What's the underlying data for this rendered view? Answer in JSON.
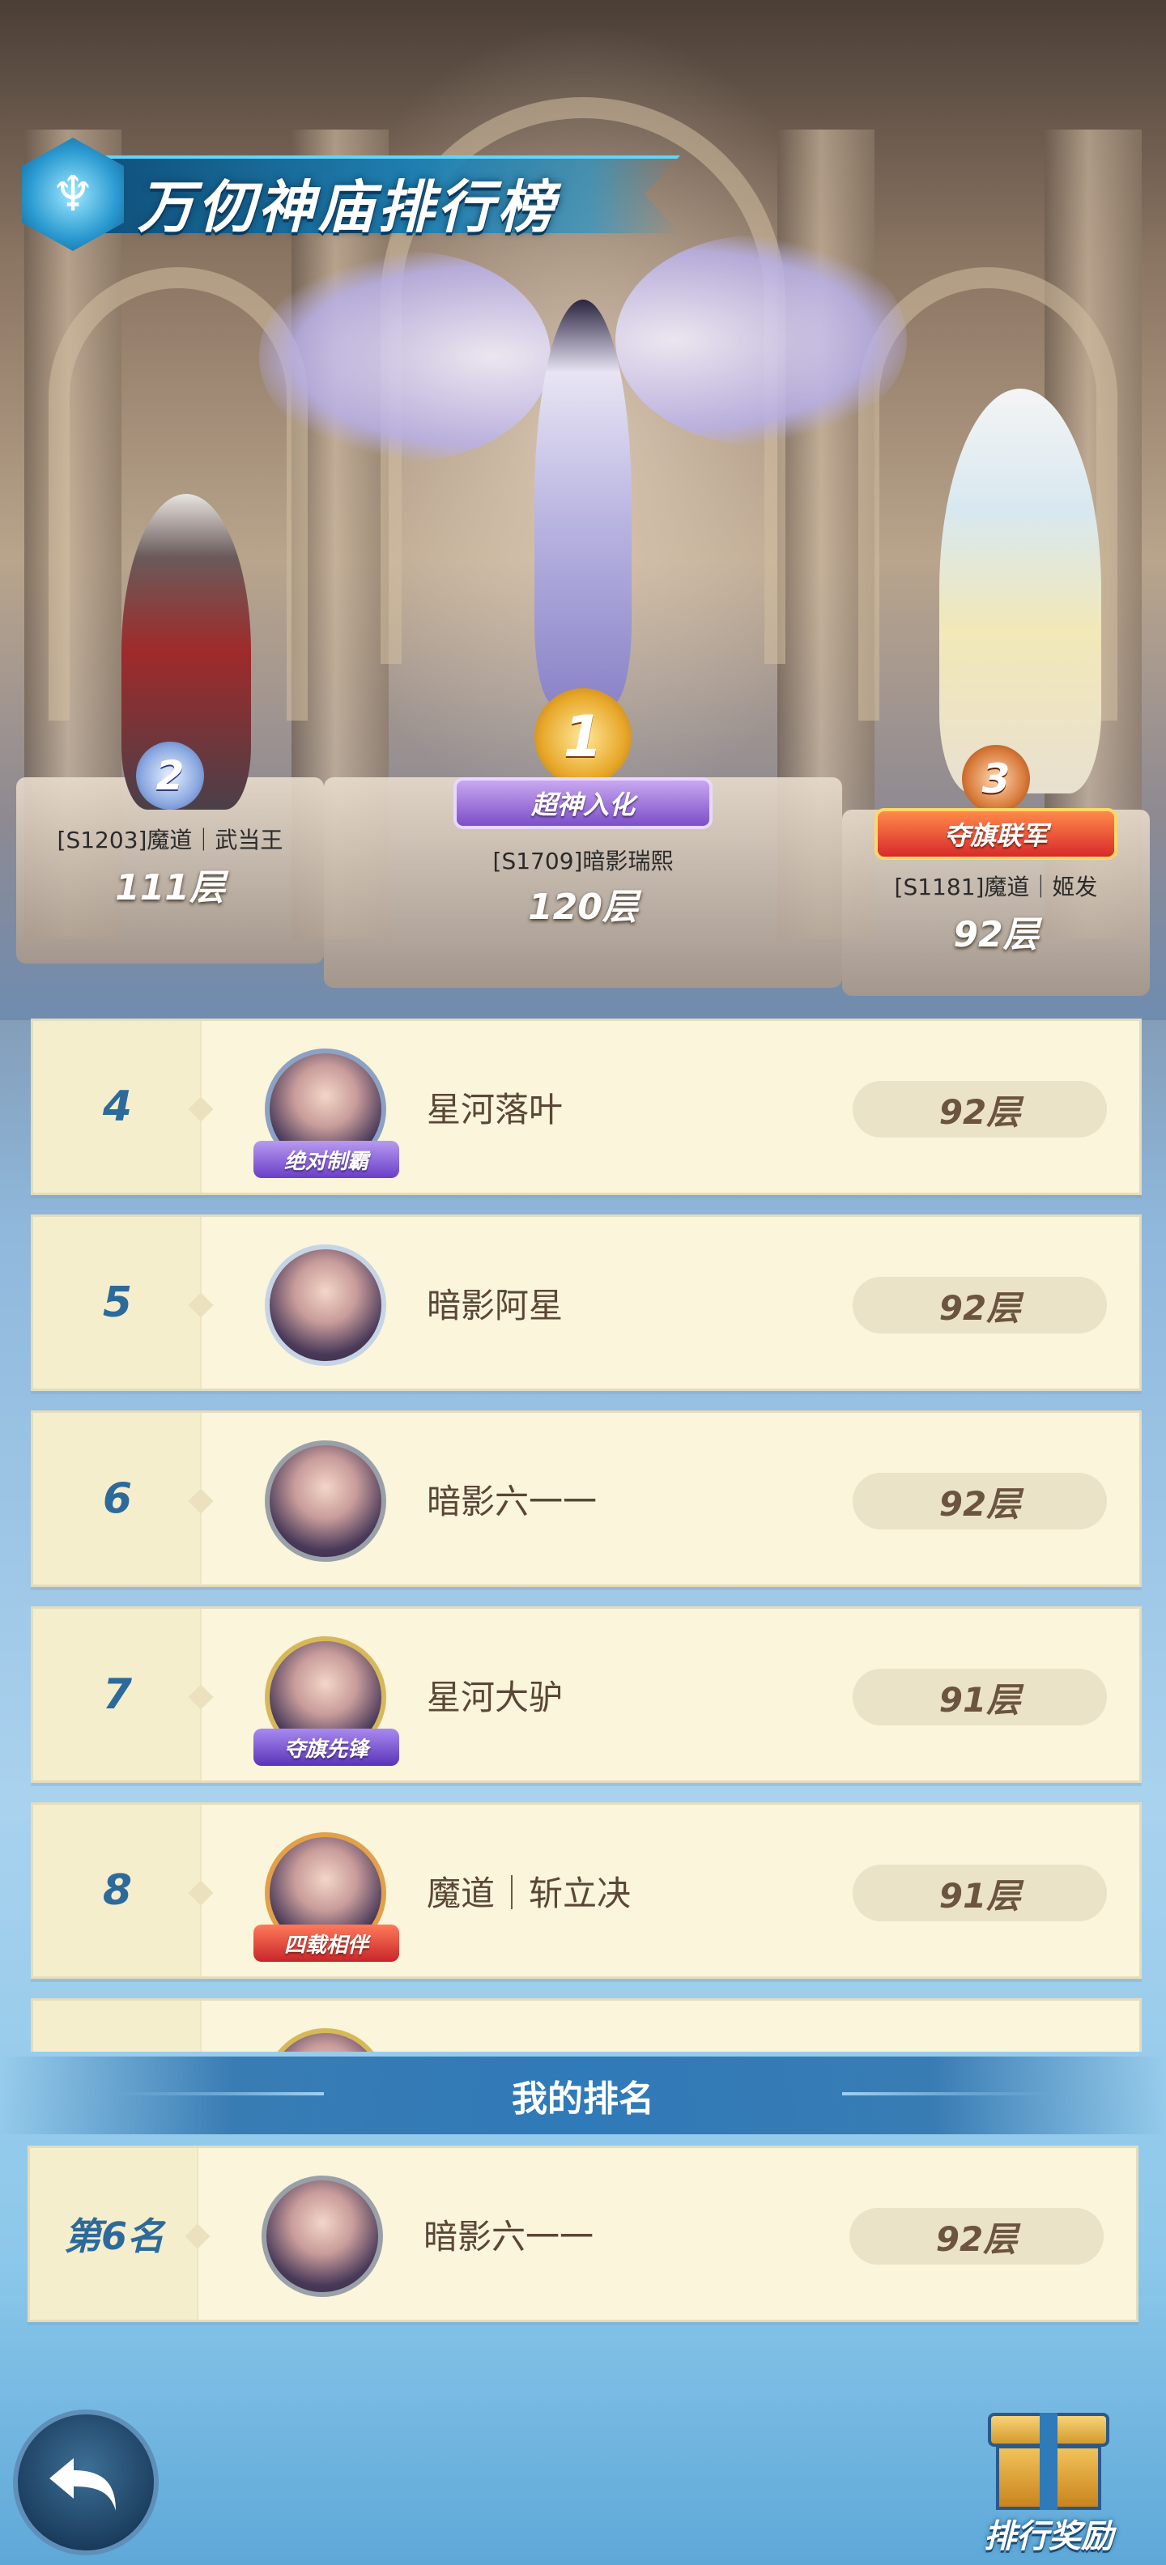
{
  "title": "万仞神庙排行榜",
  "podium": [
    {
      "rank": "1",
      "server_name": "[S1709]暗影瑞熙",
      "floors": "120层",
      "badge": "超神入化"
    },
    {
      "rank": "2",
      "server_name": "[S1203]魔道｜武当王",
      "floors": "111层",
      "badge": ""
    },
    {
      "rank": "3",
      "server_name": "[S1181]魔道｜姬发",
      "floors": "92层",
      "badge": "夺旗联军"
    }
  ],
  "rankings": [
    {
      "rank": "4",
      "name": "星河落叶",
      "floors": "92层",
      "frame_tag": "绝对制霸"
    },
    {
      "rank": "5",
      "name": "暗影阿星",
      "floors": "92层",
      "frame_tag": ""
    },
    {
      "rank": "6",
      "name": "暗影六一一",
      "floors": "92层",
      "frame_tag": ""
    },
    {
      "rank": "7",
      "name": "星河大驴",
      "floors": "91层",
      "frame_tag": "夺旗先锋"
    },
    {
      "rank": "8",
      "name": "魔道｜斩立决",
      "floors": "91层",
      "frame_tag": "四载相伴"
    }
  ],
  "my_ranking": {
    "header": "我的排名",
    "rank_label": "第6名",
    "name": "暗影六一一",
    "floors": "92层"
  },
  "buttons": {
    "reward_label": "排行奖励"
  },
  "icons": {
    "back": "back-arrow-icon",
    "reward": "gift-box-icon",
    "title_emblem": "crest-icon"
  },
  "colors": {
    "rank_number": "#2d6a9c",
    "row_background": "#faf5db",
    "floor_text": "#6b5440",
    "header_blue": "#2f7ab8"
  }
}
